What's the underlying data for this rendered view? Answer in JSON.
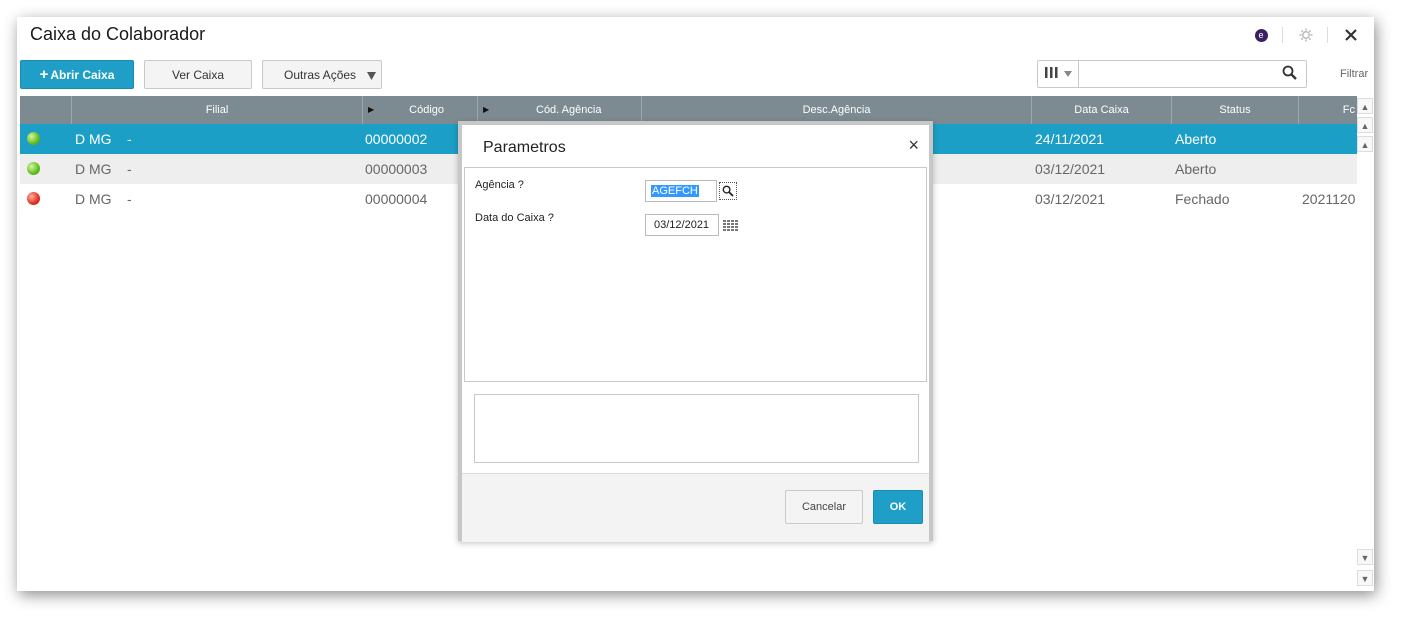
{
  "window": {
    "title": "Caixa do Colaborador",
    "purple_icon": "e"
  },
  "toolbar": {
    "abrir_label": "Abrir Caixa",
    "abrir_plus": "+",
    "ver_label": "Ver Caixa",
    "outras_label": "Outras Ações",
    "filtrar_label": "Filtrar",
    "search_placeholder": ""
  },
  "grid": {
    "columns": [
      "",
      "Filial",
      "Código",
      "Cód. Agência",
      "Desc.Agência",
      "Data Caixa",
      "Status",
      "Fc"
    ],
    "rows": [
      {
        "status_color": "green",
        "filial": "D MG",
        "filial_sep": "-",
        "codigo": "00000002",
        "data": "24/11/2021",
        "status": "Aberto",
        "extra": ""
      },
      {
        "status_color": "green",
        "filial": "D MG",
        "filial_sep": "-",
        "codigo": "00000003",
        "data": "03/12/2021",
        "status": "Aberto",
        "extra": ""
      },
      {
        "status_color": "red",
        "filial": "D MG",
        "filial_sep": "-",
        "codigo": "00000004",
        "data": "03/12/2021",
        "status": "Fechado",
        "extra": "2021120"
      }
    ]
  },
  "modal": {
    "title": "Parametros",
    "close": "×",
    "agencia_label": "Agência ?",
    "agencia_value": "AGEFCH",
    "data_label": "Data do Caixa ?",
    "data_value": "03/12/2021",
    "cancel_label": "Cancelar",
    "ok_label": "OK"
  },
  "colors": {
    "primary": "#1f9ec7",
    "selected_row": "#1c9fc6",
    "grid_header": "#7c8a92"
  }
}
